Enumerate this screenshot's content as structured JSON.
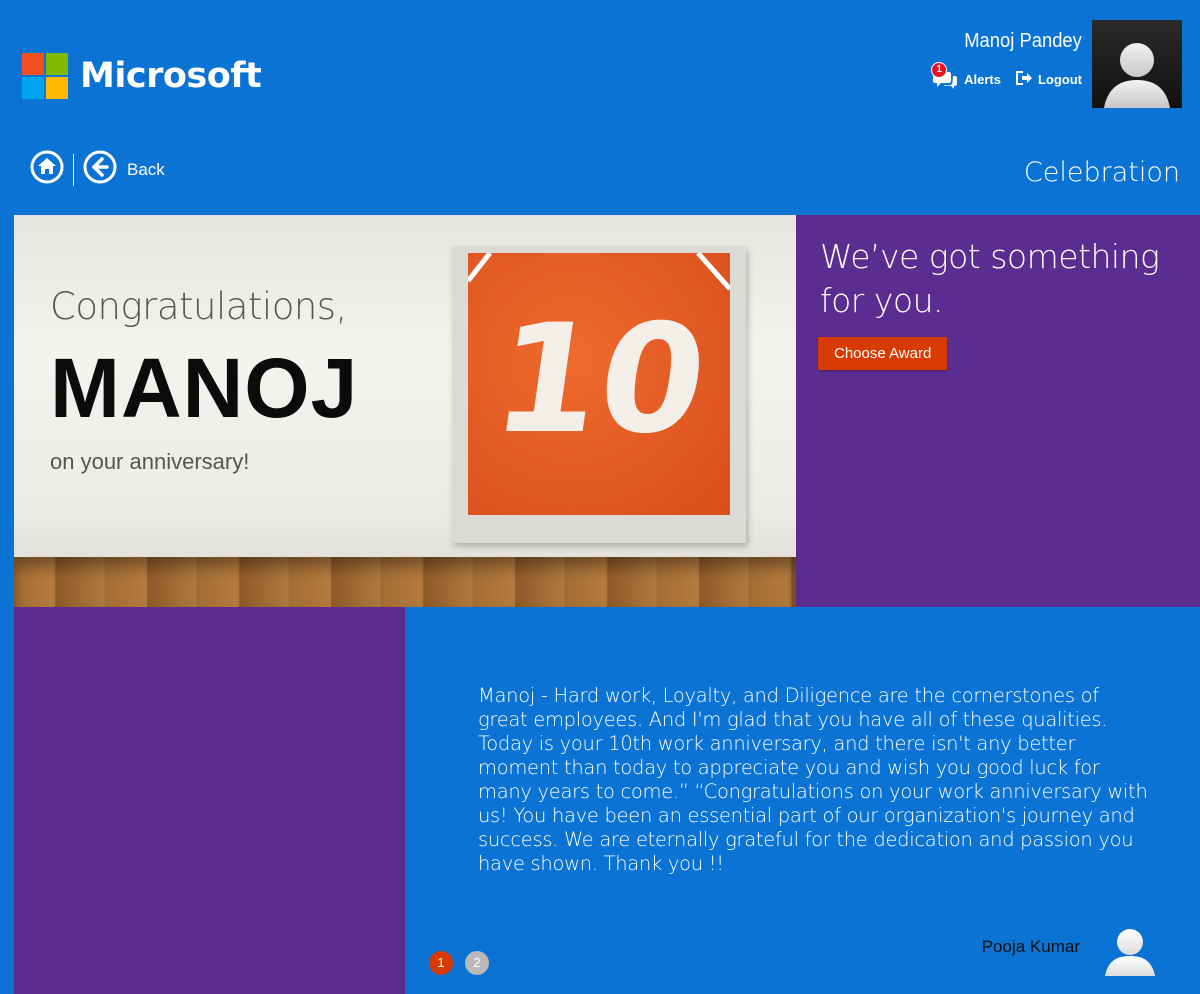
{
  "brand": {
    "name": "Microsoft",
    "logo_colors": [
      "#f25022",
      "#7fba00",
      "#00a4ef",
      "#ffb900"
    ]
  },
  "user": {
    "name": "Manoj Pandey",
    "alerts_label": "Alerts",
    "alerts_count": "1",
    "logout_label": "Logout"
  },
  "nav": {
    "back_label": "Back",
    "page_title": "Celebration"
  },
  "hero": {
    "greeting": "Congratulations,",
    "name": "MANOJ",
    "subtitle": "on your anniversary!",
    "number": "10"
  },
  "panel": {
    "heading": "We’ve got something for you.",
    "button_label": "Choose Award"
  },
  "message": {
    "text": "Manoj - Hard work, Loyalty, and Diligence are the cornerstones of great employees. And I'm glad that you have all of these qualities. Today is your 10th work anniversary, and there isn't any better moment than today to appreciate you and wish you good luck for many years to come.” “Congratulations on your work anniversary with us! You have been an essential part of our organization's journey and success. We are eternally grateful for the dedication and passion you have shown. Thank you !!",
    "sender": "Pooja Kumar"
  },
  "pagination": {
    "pages": [
      "1",
      "2"
    ],
    "current": "1"
  },
  "colors": {
    "background": "#0a73d4",
    "purple": "#5c2d91",
    "accent": "#d83b01",
    "badge": "#e81123"
  }
}
